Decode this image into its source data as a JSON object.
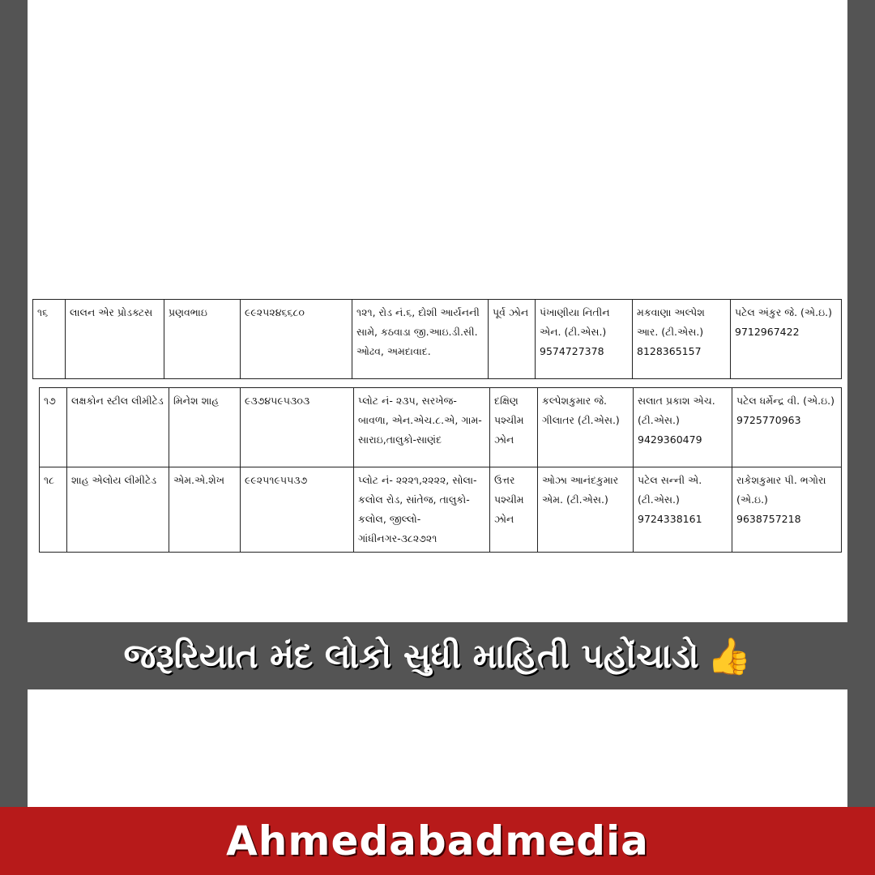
{
  "rows": [
    {
      "no": "૧૬",
      "company": "લાલન એર પ્રોડક્ટસ",
      "contact_person": "પ્રણવભાઇ",
      "mobile": "૯૯૨૫૨૪૬૬૮૦",
      "address": "૧૨૧, રોડ નં.૬, દોશી આર્યનની સામે, કઠવાડા જી.આઇ.ડી.સી. ઓઢવ, અમદાવાદ.",
      "zone": "પૂર્વ ઝોન",
      "officer1": "પંખાણીયા નિતીન એન. (ટી.એસ.)",
      "officer1_phone": "9574727378",
      "officer2": "મકવાણા અલ્પેશ આર. (ટી.એસ.)",
      "officer2_phone": "8128365157",
      "officer3": "પટેલ અંકુર જે. (એ.ઇ.)",
      "officer3_phone": "9712967422"
    },
    {
      "no": "૧૭",
      "company": "લક્ષકોન સ્ટીલ લીમીટેડ",
      "contact_person": "મિનેશ શાહ",
      "mobile": "૯૩૭૪૫૯૫૩૦૩",
      "address": "પ્લોટ નં- ૨૩૫, સરખેજ-બાવળા, એન.એચ.૮.એ, ગામ-સારાઇ,તાલુકો-સાણંદ",
      "zone": "દક્ષિણ પશ્ચીમ ઝોન",
      "officer1": "કલ્પેશકુમાર જે. ગીલાતર (ટી.એસ.)",
      "officer1_phone": "",
      "officer2": "સલાત પ્રકાશ એચ. (ટી.એસ.)",
      "officer2_phone": "9429360479",
      "officer3": "પટેલ ધર્મેન્દ્ર વી. (એ.ઇ.)",
      "officer3_phone": "9725770963"
    },
    {
      "no": "૧૮",
      "company": "શાહ એલોય લીમીટેડ",
      "contact_person": "એમ.એ.શેખ",
      "mobile": "૯૯૨૫૧૯૫૫૩૭",
      "address": "પ્લોટ નં- ૨૨૨૧,૨૨૨૨, સોલા-કલોલ રોડ, સાંતેજ, તાલુકો-કલોલ, જીલ્લો-ગાંધીનગર-૩૮૨૭૨૧",
      "zone": "ઉત્તર પશ્ચીમ ઝોન",
      "officer1": "ઓઝા આનંદકુમાર એમ. (ટી.એસ.)",
      "officer1_phone": "",
      "officer2": "પટેલ સન્ની એ. (ટી.એસ.)",
      "officer2_phone": "9724338161",
      "officer3": "રાકેશકુમાર પી. ભગોરા (એ.ઇ.)",
      "officer3_phone": "9638757218"
    }
  ],
  "banner": {
    "text": "જરૂરિયાત મંદ લોકો સુધી માહિતી પહોંચાડો",
    "icon": "thumbs-up-icon",
    "icon_glyph": "👍"
  },
  "footer": {
    "brand": "Ahmedabadmedia"
  },
  "colors": {
    "background": "#545454",
    "footer": "#b71a1a",
    "paper": "#ffffff"
  }
}
